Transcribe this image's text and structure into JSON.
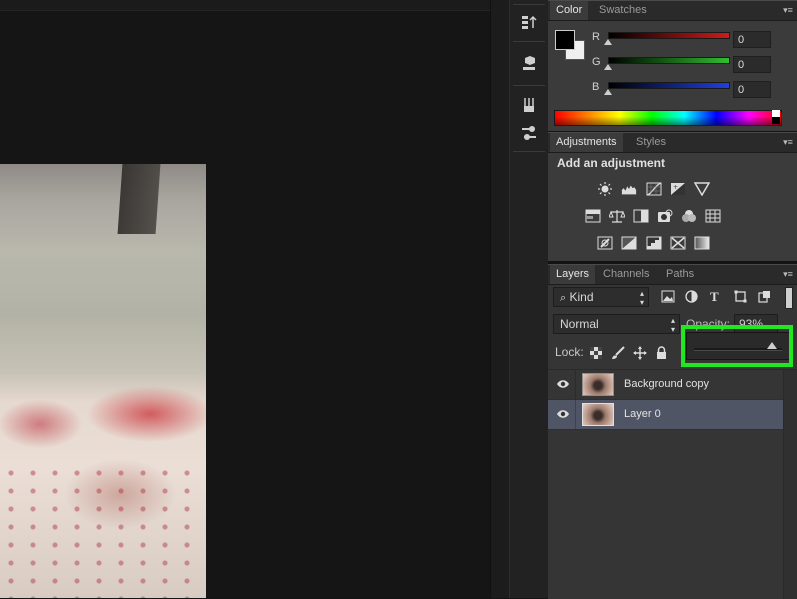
{
  "color_panel": {
    "tabs": [
      "Color",
      "Swatches"
    ],
    "channels": [
      {
        "label": "R",
        "value": "0",
        "color": "#d11a1a"
      },
      {
        "label": "G",
        "value": "0",
        "color": "#2fbf2f"
      },
      {
        "label": "B",
        "value": "0",
        "color": "#1f3fe0"
      }
    ],
    "foreground_color": "#000000",
    "background_color": "#ffffff"
  },
  "adjustments_panel": {
    "tabs": [
      "Adjustments",
      "Styles"
    ],
    "heading": "Add an adjustment",
    "icons_row1": [
      "brightness-contrast-icon",
      "levels-icon",
      "curves-icon",
      "exposure-icon",
      "gradient-triangle-icon"
    ],
    "icons_row2": [
      "vibrance-icon",
      "color-balance-icon",
      "black-white-icon",
      "photo-filter-icon",
      "channel-mixer-icon",
      "color-lookup-icon"
    ],
    "icons_row3": [
      "invert-icon",
      "posterize-icon",
      "threshold-icon",
      "selective-color-icon",
      "gradient-map-icon"
    ]
  },
  "layers_panel": {
    "tabs": [
      "Layers",
      "Channels",
      "Paths"
    ],
    "filter_kind": "Kind",
    "blend_mode": "Normal",
    "opacity_label": "Opacity:",
    "opacity_value": "93%",
    "lock_label": "Lock:",
    "layers": [
      {
        "name": "Background copy",
        "visible": true,
        "selected": false
      },
      {
        "name": "Layer 0",
        "visible": true,
        "selected": true
      }
    ]
  },
  "toolstrip": {
    "icons": [
      "history-icon",
      "3d-icon",
      "brush-presets-icon",
      "clone-source-icon"
    ]
  },
  "colors": {
    "panel_bg": "#3b3b3b",
    "selected_row": "#4f5564",
    "highlight": "#22e622"
  }
}
